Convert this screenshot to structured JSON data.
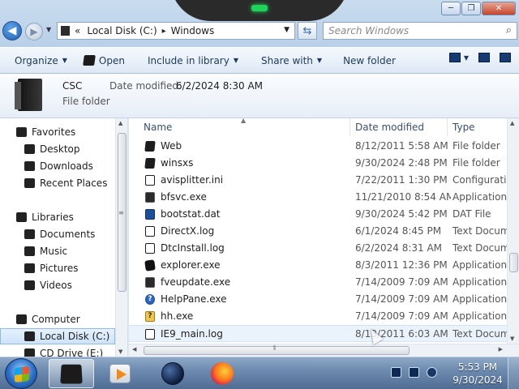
{
  "window": {
    "controls": {
      "minimize": "─",
      "maximize": "❐",
      "close": "✕"
    }
  },
  "nav": {
    "back": "◀",
    "forward": "▶",
    "history": "▼"
  },
  "address": {
    "prefix": "«",
    "segments": [
      "Local Disk (C:)",
      "Windows"
    ],
    "separator": "▸",
    "dropdown": "▼"
  },
  "refresh_glyph": "⇆",
  "search": {
    "placeholder": "Search Windows",
    "glyph": "⌕"
  },
  "commandbar": {
    "organize": "Organize",
    "open": "Open",
    "include_in_library": "Include in library",
    "share_with": "Share with",
    "new_folder": "New folder",
    "arrow": "▼"
  },
  "details": {
    "name": "CSC",
    "type": "File folder",
    "modified_label": "Date modified:",
    "modified_value": "6/2/2024 8:30 AM"
  },
  "navpane": {
    "favorites": "Favorites",
    "desktop": "Desktop",
    "downloads": "Downloads",
    "recent_places": "Recent Places",
    "libraries": "Libraries",
    "documents": "Documents",
    "music": "Music",
    "pictures": "Pictures",
    "videos": "Videos",
    "computer": "Computer",
    "local_disk": "Local Disk (C:)",
    "cd_drive": "CD Drive (E:)"
  },
  "columns": {
    "name": "Name",
    "date_modified": "Date modified",
    "type": "Type",
    "sort_glyph": "▲"
  },
  "files": [
    {
      "name": "Web",
      "date": "8/12/2011 5:58 AM",
      "type": "File folder",
      "icon": "folder-icon"
    },
    {
      "name": "winsxs",
      "date": "9/30/2024 2:48 PM",
      "type": "File folder",
      "icon": "folder-icon"
    },
    {
      "name": "avisplitter.ini",
      "date": "7/22/2011 1:30 PM",
      "type": "Configuratio",
      "icon": "settings-file-icon"
    },
    {
      "name": "bfsvc.exe",
      "date": "11/21/2010 8:54 AM",
      "type": "Application",
      "icon": "application-icon"
    },
    {
      "name": "bootstat.dat",
      "date": "9/30/2024 5:42 PM",
      "type": "DAT File",
      "icon": "dat-file-icon"
    },
    {
      "name": "DirectX.log",
      "date": "6/1/2024 8:45 PM",
      "type": "Text Docum",
      "icon": "text-file-icon"
    },
    {
      "name": "DtcInstall.log",
      "date": "6/2/2024 8:31 AM",
      "type": "Text Docum",
      "icon": "text-file-icon"
    },
    {
      "name": "explorer.exe",
      "date": "8/3/2011 12:36 PM",
      "type": "Application",
      "icon": "explorer-icon"
    },
    {
      "name": "fveupdate.exe",
      "date": "7/14/2009 7:09 AM",
      "type": "Application",
      "icon": "application-icon"
    },
    {
      "name": "HelpPane.exe",
      "date": "7/14/2009 7:09 AM",
      "type": "Application",
      "icon": "help-icon"
    },
    {
      "name": "hh.exe",
      "date": "7/14/2009 7:09 AM",
      "type": "Application",
      "icon": "help-book-icon"
    },
    {
      "name": "IE9_main.log",
      "date": "8/13/2011 6:03 AM",
      "type": "Text Docum",
      "icon": "text-file-icon"
    }
  ],
  "scroll": {
    "up": "▲",
    "down": "▼",
    "left": "◀",
    "right": "▶",
    "grip": "≡",
    "hgrip": "⦀"
  },
  "taskbar": {
    "time": "5:53 PM",
    "date": "9/30/2024"
  }
}
